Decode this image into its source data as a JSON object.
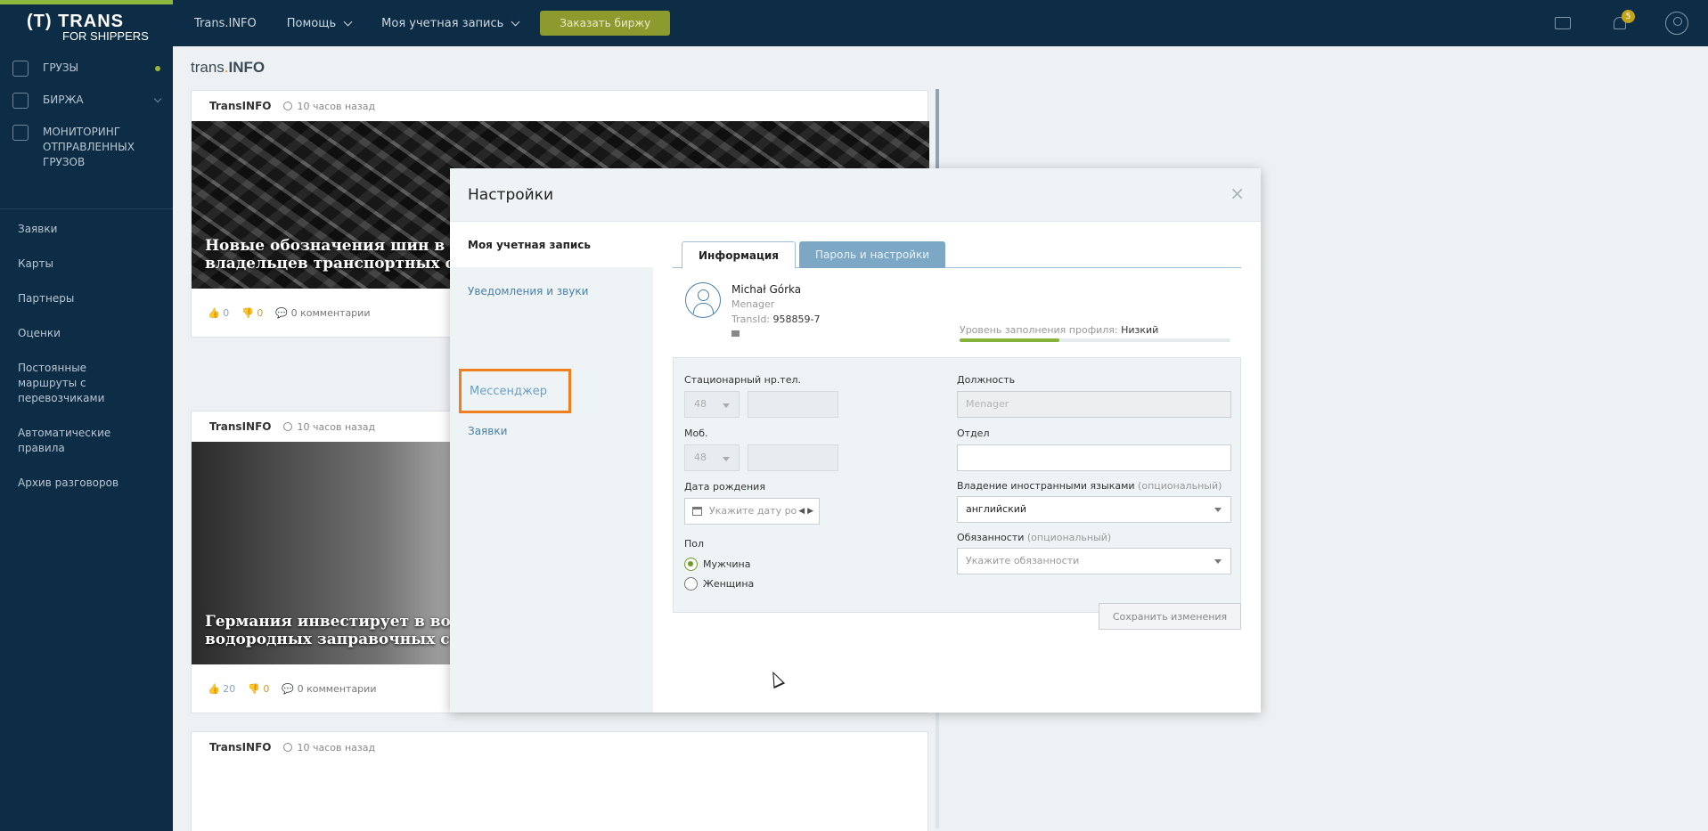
{
  "topbar": {
    "logo_line1": "(T) TRANS",
    "logo_line2": "FOR SHIPPERS",
    "nav": [
      {
        "label": "Trans.INFO"
      },
      {
        "label": "Помощь"
      },
      {
        "label": "Моя учетная запись"
      }
    ],
    "order_button": "Заказать биржу",
    "notification_count": "5"
  },
  "sidebar": {
    "main_items": [
      {
        "label": "ГРУЗЫ",
        "icon": "cargo-icon"
      },
      {
        "label": "БИРЖА",
        "icon": "exchange-icon"
      },
      {
        "label": "МОНИТОРИНГ ОТПРАВЛЕННЫХ ГРУЗОВ",
        "icon": "monitoring-icon"
      }
    ],
    "items": [
      {
        "label": "Заявки"
      },
      {
        "label": "Карты"
      },
      {
        "label": "Партнеры"
      },
      {
        "label": "Оценки"
      },
      {
        "label": "Постоянные маршруты с перевозчиками"
      },
      {
        "label": "Автоматические правила"
      },
      {
        "label": "Архив разговоров"
      }
    ]
  },
  "feed": {
    "logo_text": "trans",
    "logo_dot": ".",
    "logo_bold": "INFO",
    "cards": [
      {
        "source": "TransINFO",
        "time": "10 часов назад",
        "title": "Новые обозначения шин в Европ\nвладельцев транспортных средс",
        "likes": "0",
        "dislikes": "0",
        "comments": "0 комментарии"
      },
      {
        "source": "TransINFO",
        "time": "10 часов назад",
        "title": "Германия инвестирует в водород\nводородных заправочных станци",
        "likes": "20",
        "dislikes": "0",
        "comments": "0 комментарии"
      },
      {
        "source": "TransINFO",
        "time": "10 часов назад"
      }
    ]
  },
  "modal": {
    "title": "Настройки",
    "close": "×",
    "side": {
      "active": "Моя учетная запись",
      "notifications": "Уведомления и звуки",
      "messenger": "Мессенджер",
      "requests": "Заявки"
    },
    "tabs": [
      {
        "label": "Информация"
      },
      {
        "label": "Пароль и настройки"
      }
    ],
    "profile": {
      "name": "Michał Górka",
      "role": "Menager",
      "transid_label": "TransId:",
      "transid_value": "958859-7",
      "fill_label": "Уровень заполнения профиля:",
      "fill_value": "Низкий",
      "fill_level": 0.37
    },
    "form": {
      "landline_label": "Стационарный нр.тел.",
      "landline_code": "48",
      "mobile_label": "Моб.",
      "mobile_code": "48",
      "birth_label": "Дата рождения",
      "birth_placeholder": "Укажите дату ро",
      "gender_label": "Пол",
      "male": "Мужчина",
      "female": "Женщина",
      "position_label": "Должность",
      "position_value": "Menager",
      "department_label": "Отдел",
      "languages_label": "Владение иностранными языками",
      "optional": "(опциональный)",
      "languages_value": "английский",
      "duties_label": "Обязанности",
      "duties_placeholder": "Укажите обязанности"
    },
    "save_button": "Сохранить изменения"
  }
}
